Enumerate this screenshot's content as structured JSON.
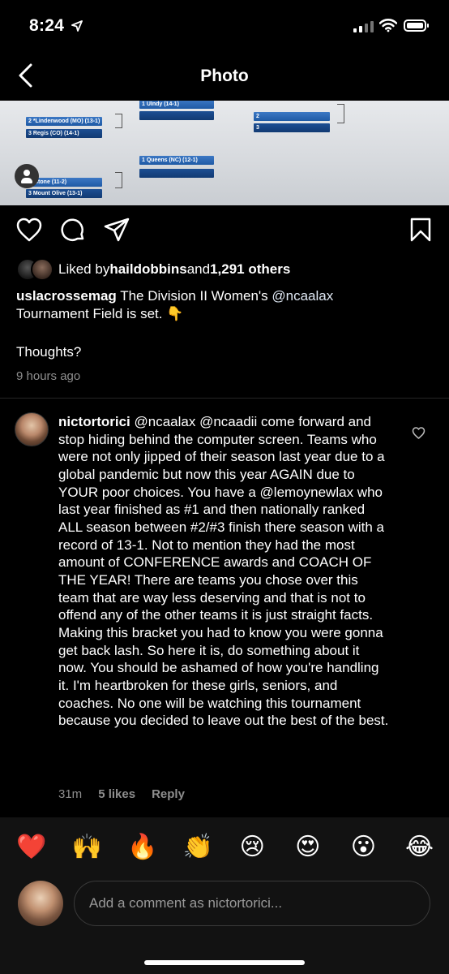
{
  "status_bar": {
    "time": "8:24"
  },
  "header": {
    "title": "Photo"
  },
  "photo": {
    "bracket_slots": [
      "1 UIndy (14-1)",
      "",
      "2 *Lindenwood (MO) (13-1)",
      "3 Regis (CO) (14-1)",
      "2",
      "3",
      "1 Queens (NC) (12-1)",
      "",
      "nestone (11-2)",
      "3 Mount Olive (13-1)"
    ]
  },
  "likes": {
    "prefix": "Liked by ",
    "user": "haildobbins",
    "middle": " and ",
    "count": "1,291 others"
  },
  "caption": {
    "user": "uslacrossemag",
    "text_1": " The Division II Women's ",
    "mention": "@ncaalax",
    "text_2": " Tournament Field is set. ",
    "emoji": "👇",
    "thoughts": "Thoughts?",
    "time": "9 hours ago"
  },
  "comment": {
    "user": "nictortorici",
    "text": " @ncaalax @ncaadii come forward and stop hiding behind the computer screen. Teams who were not only jipped of their season last year due to a global pandemic but now this year AGAIN due to YOUR poor choices. You have a @lemoynewlax who last year finished as #1 and then nationally ranked ALL season between #2/#3 finish there season with a record of 13-1. Not to mention they had the most amount of CONFERENCE awards and COACH OF THE YEAR! There are teams you chose over this team that are way less deserving and that is not to offend any of the other teams it is just straight facts. Making this bracket you had to know you were gonna get back lash. So here it is, do something about it now. You should be ashamed of how you're handling it. I'm heartbroken for these girls, seniors, and coaches. No one will be watching this tournament because you decided to leave out the best of the best.",
    "time": "31m",
    "likes": "5 likes",
    "reply": "Reply"
  },
  "emoji_bar": [
    "❤️",
    "🙌",
    "🔥",
    "👏",
    "😢",
    "😍",
    "😮",
    "😂"
  ],
  "comment_input": {
    "placeholder": "Add a comment as nictortorici..."
  }
}
